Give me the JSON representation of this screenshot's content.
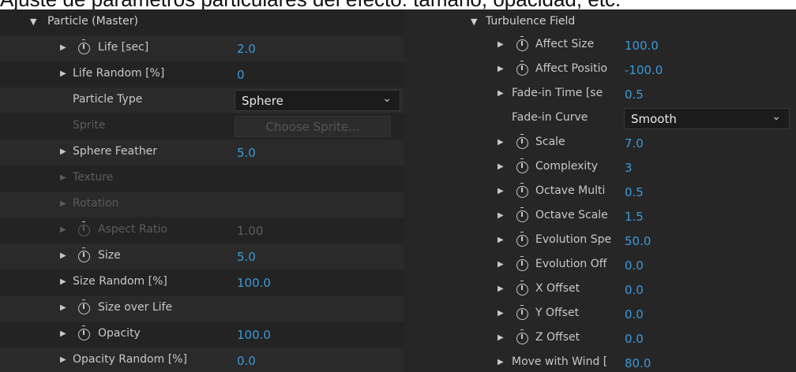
{
  "caption": "Ajuste de parámetros particulares del efecto: tamaño, opacidad, etc.",
  "left_panel": {
    "section_title": "Particle (Master)",
    "rows": [
      {
        "label": "Life [sec]",
        "value": "2.0"
      },
      {
        "label": "Life Random [%]",
        "value": "0"
      },
      {
        "label": "Particle Type",
        "select_value": "Sphere"
      },
      {
        "label": "Sprite",
        "button_label": "Choose Sprite..."
      },
      {
        "label": "Sphere Feather",
        "value": "5.0"
      },
      {
        "label": "Texture"
      },
      {
        "label": "Rotation"
      },
      {
        "label": "Aspect Ratio",
        "value": "1.00"
      },
      {
        "label": "Size",
        "value": "5.0"
      },
      {
        "label": "Size Random [%]",
        "value": "100.0"
      },
      {
        "label": "Size over Life"
      },
      {
        "label": "Opacity",
        "value": "100.0"
      },
      {
        "label": "Opacity Random [%]",
        "value": "0.0"
      }
    ]
  },
  "right_panel": {
    "section_title": "Turbulence Field",
    "rows": [
      {
        "label": "Affect Size",
        "value": "100.0"
      },
      {
        "label": "Affect Positio",
        "value": "-100.0"
      },
      {
        "label": "Fade-in Time [se",
        "value": "0.5"
      },
      {
        "label": "Fade-in Curve",
        "select_value": "Smooth"
      },
      {
        "label": "Scale",
        "value": "7.0"
      },
      {
        "label": "Complexity",
        "value": "3"
      },
      {
        "label": "Octave Multi",
        "value": "0.5"
      },
      {
        "label": "Octave Scale",
        "value": "1.5"
      },
      {
        "label": "Evolution Spe",
        "value": "50.0"
      },
      {
        "label": "Evolution Off",
        "value": "0.0"
      },
      {
        "label": "X Offset",
        "value": "0.0"
      },
      {
        "label": "Y Offset",
        "value": "0.0"
      },
      {
        "label": "Z Offset",
        "value": "0.0"
      },
      {
        "label": "Move with Wind [",
        "value": "80.0"
      }
    ]
  },
  "icons": {
    "expand": "triangle-right-icon",
    "collapse": "triangle-down-icon",
    "stopwatch": "stopwatch-icon",
    "dropdown": "chevron-down-icon"
  },
  "colors": {
    "value_blue": "#3a9ad9",
    "panel_bg": "#232323"
  }
}
